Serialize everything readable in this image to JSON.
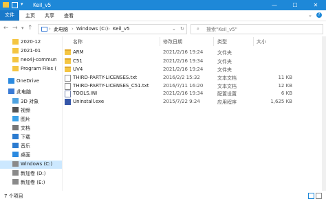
{
  "window": {
    "title": "Keil_v5",
    "accent": "#1e88d8"
  },
  "ribbon": {
    "tabs": [
      "文件",
      "主页",
      "共享",
      "查看"
    ]
  },
  "address": {
    "segments": [
      "此电脑",
      "Windows (C:)",
      "Keil_v5"
    ],
    "search_placeholder": "搜索\"Keil_v5\""
  },
  "sidebar": {
    "items": [
      {
        "label": "2020-12",
        "icon": "folder-icon"
      },
      {
        "label": "2021-01",
        "icon": "folder-icon"
      },
      {
        "label": "neo4j-commun",
        "icon": "folder-icon"
      },
      {
        "label": "Program Files (",
        "icon": "folder-icon"
      },
      {
        "label": "OneDrive",
        "icon": "cloud-icon"
      },
      {
        "label": "此电脑",
        "icon": "computer-icon"
      },
      {
        "label": "3D 对象",
        "icon": "cube-icon"
      },
      {
        "label": "视频",
        "icon": "video-icon"
      },
      {
        "label": "图片",
        "icon": "picture-icon"
      },
      {
        "label": "文档",
        "icon": "document-icon"
      },
      {
        "label": "下载",
        "icon": "download-icon"
      },
      {
        "label": "音乐",
        "icon": "music-icon"
      },
      {
        "label": "桌面",
        "icon": "desktop-icon"
      },
      {
        "label": "Windows (C:)",
        "icon": "drive-icon"
      },
      {
        "label": "新加卷 (D:)",
        "icon": "drive-icon"
      },
      {
        "label": "新加卷 (E:)",
        "icon": "drive-icon"
      }
    ]
  },
  "columns": {
    "name": "名称",
    "date": "修改日期",
    "type": "类型",
    "size": "大小"
  },
  "files": [
    {
      "name": "ARM",
      "date": "2021/2/16 19:24",
      "type": "文件夹",
      "size": "",
      "icon": "folder-icon"
    },
    {
      "name": "C51",
      "date": "2021/2/16 19:34",
      "type": "文件夹",
      "size": "",
      "icon": "folder-icon"
    },
    {
      "name": "UV4",
      "date": "2021/2/16 19:24",
      "type": "文件夹",
      "size": "",
      "icon": "folder-icon"
    },
    {
      "name": "THIRD-PARTY-LICENSES.txt",
      "date": "2016/2/2 15:32",
      "type": "文本文档",
      "size": "11 KB",
      "icon": "text-file-icon"
    },
    {
      "name": "THIRD-PARTY-LICENSES_C51.txt",
      "date": "2016/7/11 16:20",
      "type": "文本文档",
      "size": "12 KB",
      "icon": "text-file-icon"
    },
    {
      "name": "TOOLS.INI",
      "date": "2021/2/16 19:34",
      "type": "配置设置",
      "size": "6 KB",
      "icon": "ini-file-icon"
    },
    {
      "name": "Uninstall.exe",
      "date": "2015/7/22 9:24",
      "type": "应用程序",
      "size": "1,625 KB",
      "icon": "exe-file-icon"
    }
  ],
  "status": {
    "count": "7 个项目"
  }
}
